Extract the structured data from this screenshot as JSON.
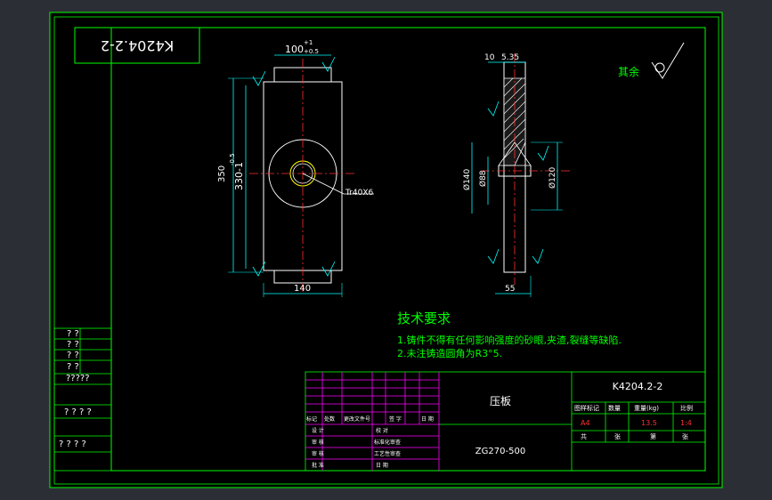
{
  "drawing": {
    "mirror_code": "K4204.2-2",
    "code": "K4204.2-2",
    "part_name": "压板",
    "material": "ZG270-500",
    "roughness_label": "其余",
    "tech_title": "技术要求",
    "tech_notes": [
      "1.铸件不得有任何影响强度的砂眼,夹渣,裂缝等缺陷.",
      "2.未注铸造圆角为R3°5."
    ],
    "dims_front": {
      "top_width": "100",
      "top_tol": "+1",
      "top_tol2": "+0.5",
      "height_outer": "350",
      "height_inner": "330-1",
      "height_tol": "-0.5",
      "bottom_width": "140",
      "thread": "Tr40X6"
    },
    "dims_side": {
      "top_a": "10",
      "top_b": "5.35",
      "dia_140": "Ø140",
      "dia_88": "Ø88",
      "dia_120": "Ø120",
      "bottom": "55"
    }
  },
  "title_block": {
    "right_labels": [
      "图样标记",
      "数量",
      "重量(kg)",
      "比例"
    ],
    "right_values": [
      "A4",
      "",
      "13.5",
      "1:4"
    ],
    "sheet_labels": [
      "共",
      "张",
      "第",
      "张"
    ],
    "rev_header": [
      "标记",
      "处数",
      "更改文件号",
      "签 字",
      "日 期"
    ],
    "sign_rows": [
      [
        "设 计",
        "校 对"
      ],
      [
        "审 核",
        "标准化审查"
      ],
      [
        "审 核",
        "工艺性审查"
      ],
      [
        "批 准",
        "日 期"
      ]
    ]
  },
  "left_strip": [
    "? ?",
    "? ?",
    "? ?",
    "? ?",
    "?????",
    "? ? ? ?",
    "? ? ? ?"
  ]
}
